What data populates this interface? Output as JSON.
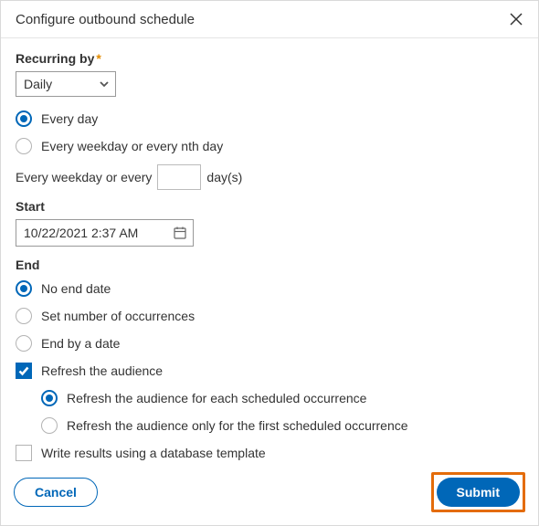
{
  "dialog": {
    "title": "Configure outbound schedule"
  },
  "recurring": {
    "label": "Recurring by",
    "required_marker": "*",
    "dropdown_value": "Daily",
    "options": {
      "every_day": "Every day",
      "every_weekday_nth": "Every weekday or every nth day"
    },
    "nth_prefix": "Every weekday or every",
    "nth_value": "",
    "nth_suffix": "day(s)"
  },
  "start": {
    "label": "Start",
    "value": "10/22/2021 2:37 AM"
  },
  "end": {
    "label": "End",
    "options": {
      "no_end": "No end date",
      "set_number": "Set number of occurrences",
      "end_by": "End by a date"
    }
  },
  "refresh": {
    "checkbox_label": "Refresh the audience",
    "options": {
      "each": "Refresh the audience for each scheduled occurrence",
      "first": "Refresh the audience only for the first scheduled occurrence"
    }
  },
  "write_template": {
    "label": "Write results using a database template"
  },
  "footer": {
    "cancel": "Cancel",
    "submit": "Submit"
  }
}
